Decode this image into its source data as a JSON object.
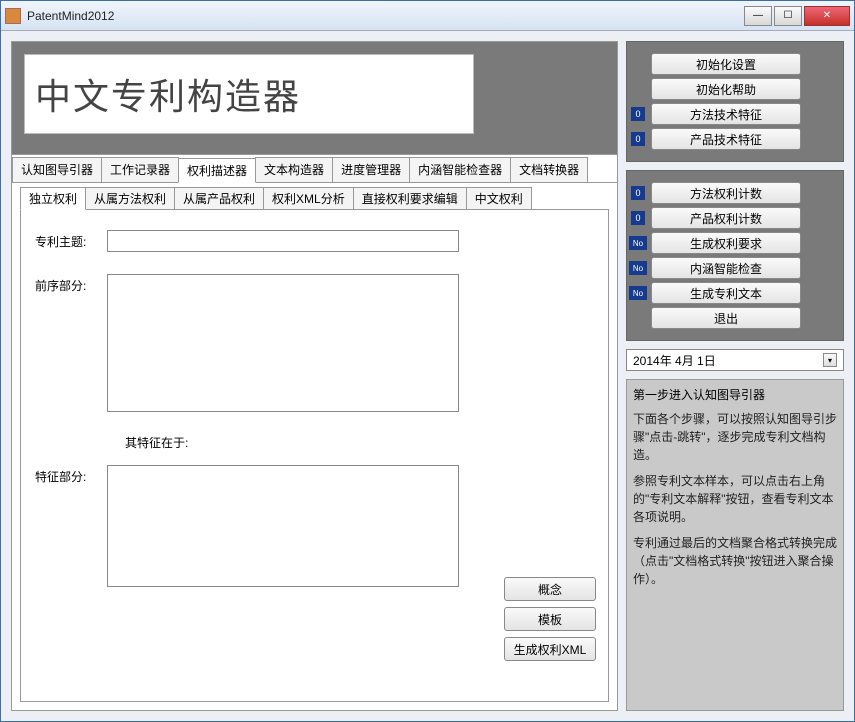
{
  "window": {
    "title": "PatentMind2012"
  },
  "banner": {
    "title": "中文专利构造器"
  },
  "mainTabs": [
    {
      "label": "认知图导引器"
    },
    {
      "label": "工作记录器"
    },
    {
      "label": "权利描述器"
    },
    {
      "label": "文本构造器"
    },
    {
      "label": "进度管理器"
    },
    {
      "label": "内涵智能检查器"
    },
    {
      "label": "文档转换器"
    }
  ],
  "subTabs": [
    {
      "label": "独立权利"
    },
    {
      "label": "从属方法权利"
    },
    {
      "label": "从属产品权利"
    },
    {
      "label": "权利XML分析"
    },
    {
      "label": "直接权利要求编辑"
    },
    {
      "label": "中文权利"
    }
  ],
  "form": {
    "subjectLabel": "专利主题:",
    "preambleLabel": "前序部分:",
    "characterizedLabel": "其特征在于:",
    "featureLabel": "特征部分:"
  },
  "actions": {
    "concept": "概念",
    "template": "模板",
    "genXml": "生成权利XML"
  },
  "sideTop": {
    "initSettings": "初始化设置",
    "initHelp": "初始化帮助",
    "methodTech": "方法技术特征",
    "productTech": "产品技术特征"
  },
  "sideMid": {
    "methodCount": "方法权利计数",
    "productCount": "产品权利计数",
    "genClaims": "生成权利要求",
    "semanticCheck": "内涵智能检查",
    "genPatentText": "生成专利文本",
    "exit": "退出"
  },
  "badges": {
    "zero": "0",
    "no": "No"
  },
  "date": {
    "value": "2014年 4月 1日"
  },
  "help": {
    "title": "第一步进入认知图导引器",
    "p1": "下面各个步骤，可以按照认知图导引步骤\"点击-跳转\"，逐步完成专利文档构造。",
    "p2": "参照专利文本样本，可以点击右上角的\"专利文本解释\"按钮，查看专利文本各项说明。",
    "p3": "专利通过最后的文档聚合格式转换完成（点击\"文档格式转换\"按钮进入聚合操作）。"
  }
}
